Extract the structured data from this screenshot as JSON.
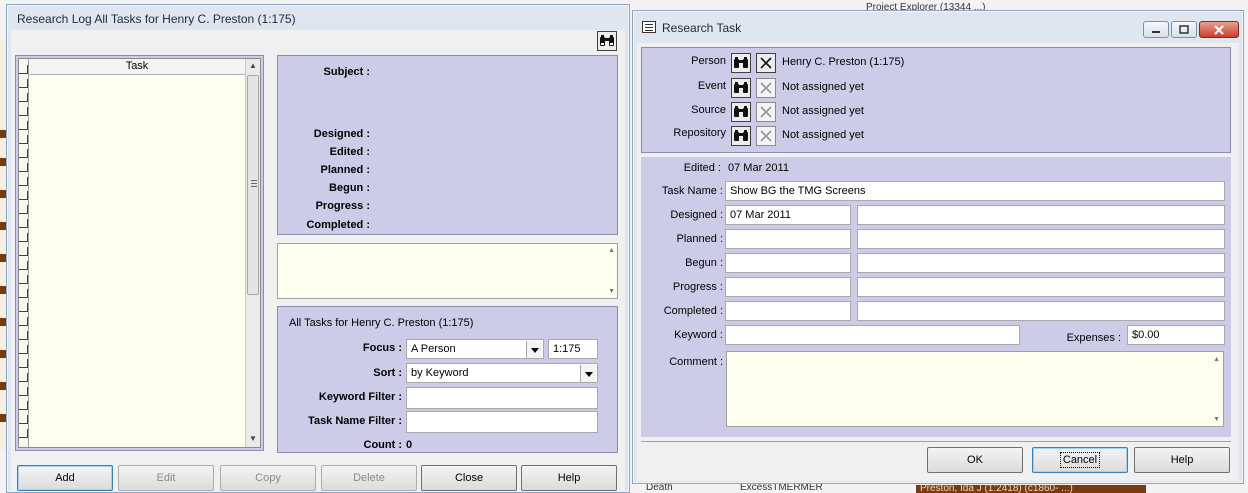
{
  "log_window": {
    "title": "Research Log All Tasks for Henry C.  Preston (1:175)",
    "task_column_header": "Task",
    "details": {
      "subject_label": "Subject :",
      "designed_label": "Designed :",
      "edited_label": "Edited :",
      "planned_label": "Planned :",
      "begun_label": "Begun :",
      "progress_label": "Progress :",
      "completed_label": "Completed :"
    },
    "filter": {
      "heading": "All Tasks for Henry C.  Preston (1:175)",
      "focus_label": "Focus :",
      "focus_value": "A Person",
      "focus_id": "1:175",
      "sort_label": "Sort :",
      "sort_value": "by Keyword",
      "keyword_filter_label": "Keyword Filter :",
      "keyword_filter_value": "",
      "task_name_filter_label": "Task Name Filter :",
      "task_name_filter_value": "",
      "count_label": "Count :",
      "count_value": "0"
    },
    "buttons": {
      "add": "Add",
      "edit": "Edit",
      "copy": "Copy",
      "delete": "Delete",
      "close": "Close",
      "help": "Help"
    }
  },
  "task_window": {
    "title": "Research Task",
    "links": [
      {
        "label": "Person",
        "value": "Henry C. Preston (1:175)"
      },
      {
        "label": "Event",
        "value": "Not assigned yet"
      },
      {
        "label": "Source",
        "value": "Not assigned yet"
      },
      {
        "label": "Repository",
        "value": "Not assigned yet"
      }
    ],
    "edited_label": "Edited :",
    "edited_value": "07 Mar 2011",
    "task_name_label": "Task Name :",
    "task_name_value": "Show BG the TMG Screens",
    "designed_label": "Designed :",
    "designed_date": "07 Mar 2011",
    "designed_note": "",
    "planned_label": "Planned :",
    "begun_label": "Begun :",
    "progress_label": "Progress :",
    "completed_label": "Completed :",
    "keyword_label": "Keyword :",
    "keyword_value": "",
    "expenses_label": "Expenses :",
    "expenses_value": "$0.00",
    "comment_label": "Comment :",
    "comment_value": "",
    "buttons": {
      "ok": "OK",
      "cancel": "Cancel",
      "help": "Help"
    }
  },
  "background": {
    "right_top_text": "Project Explorer (13344 ...)",
    "right_bottom_text": "Preston, Ida J (1:2418) (c1860- ...)",
    "left_bottom_text": "Death",
    "mid_bottom_text": "ExcessTMERMER"
  },
  "colors": {
    "panel_lavender": "#cccce8",
    "window_frame": "#dfe6f0",
    "cream_fill": "#fffff0",
    "accent_brown": "#7a3a10"
  },
  "icons": {
    "find": "binoculars-icon",
    "clear": "x-clear-icon",
    "dropdown": "chevron-down-icon"
  }
}
